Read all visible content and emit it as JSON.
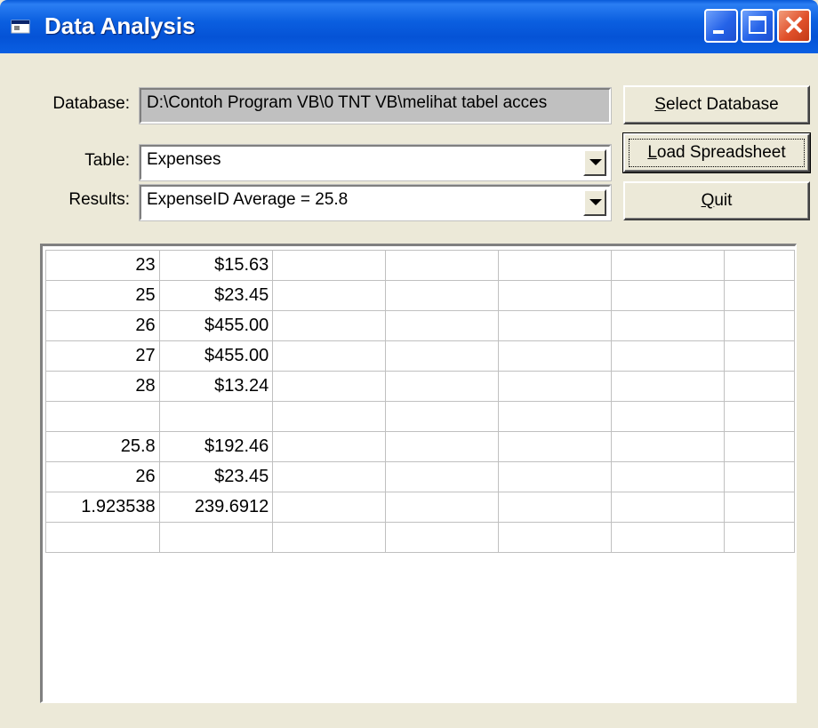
{
  "window": {
    "title": "Data Analysis"
  },
  "form": {
    "database_label": "Database:",
    "database_value": "D:\\Contoh Program VB\\0 TNT VB\\melihat tabel acces",
    "table_label": "Table:",
    "table_value": "Expenses",
    "results_label": "Results:",
    "results_value": "ExpenseID Average = 25.8"
  },
  "buttons": {
    "select_database": {
      "prefix": "",
      "accel": "S",
      "rest": "elect Database"
    },
    "load_spreadsheet": {
      "prefix": "",
      "accel": "L",
      "rest": "oad Spreadsheet"
    },
    "quit": {
      "prefix": "",
      "accel": "Q",
      "rest": "uit"
    }
  },
  "grid": {
    "rows": [
      [
        "23",
        "$15.63",
        "",
        "",
        "",
        "",
        ""
      ],
      [
        "25",
        "$23.45",
        "",
        "",
        "",
        "",
        ""
      ],
      [
        "26",
        "$455.00",
        "",
        "",
        "",
        "",
        ""
      ],
      [
        "27",
        "$455.00",
        "",
        "",
        "",
        "",
        ""
      ],
      [
        "28",
        "$13.24",
        "",
        "",
        "",
        "",
        ""
      ],
      [
        "",
        "",
        "",
        "",
        "",
        "",
        ""
      ],
      [
        "25.8",
        "$192.46",
        "",
        "",
        "",
        "",
        ""
      ],
      [
        "26",
        "$23.45",
        "",
        "",
        "",
        "",
        ""
      ],
      [
        "1.923538",
        "239.6912",
        "",
        "",
        "",
        "",
        ""
      ],
      [
        "",
        "",
        "",
        "",
        "",
        "",
        ""
      ]
    ]
  },
  "colors": {
    "titlebar": "#0553d6",
    "face": "#ece9d8",
    "readonly_field": "#c0c0c0"
  },
  "icons": {
    "title": "app-window-icon",
    "minimize": "minimize-icon",
    "maximize": "maximize-icon",
    "close": "close-icon",
    "dropdown": "chevron-down-icon"
  }
}
